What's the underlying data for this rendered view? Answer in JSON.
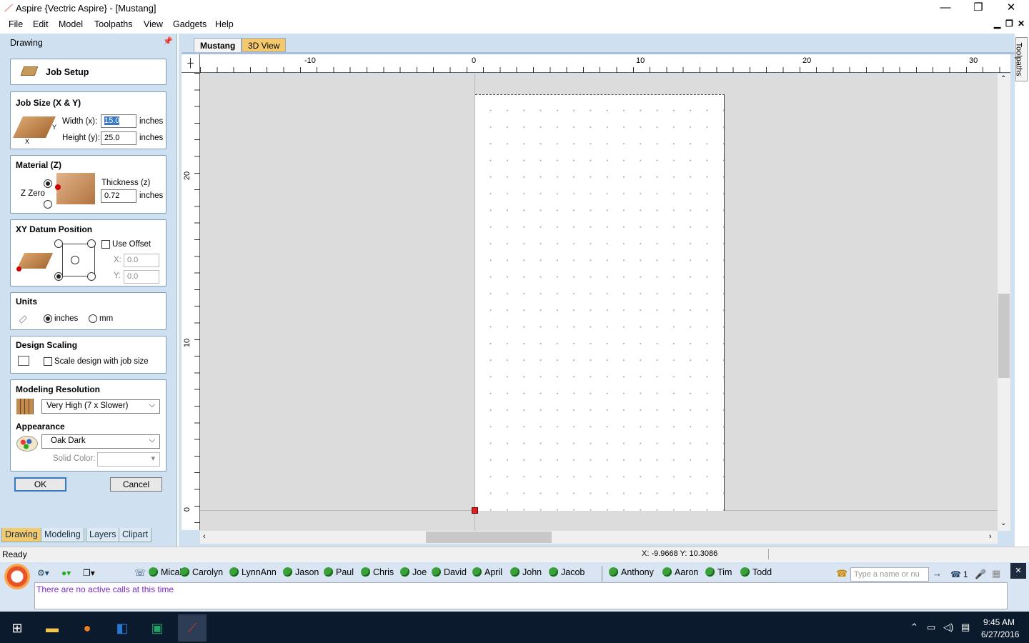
{
  "window": {
    "title": "Aspire {Vectric Aspire} - [Mustang]"
  },
  "menu": [
    "File",
    "Edit",
    "Model",
    "Toolpaths",
    "View",
    "Gadgets",
    "Help"
  ],
  "panel": {
    "title": "Drawing",
    "job_setup": "Job Setup",
    "job_size": {
      "title": "Job Size (X & Y)",
      "width_label": "Width (x):",
      "width_value": "15.0",
      "height_label": "Height (y):",
      "height_value": "25.0",
      "unit": "inches",
      "x": "X",
      "y": "Y"
    },
    "material": {
      "title": "Material (Z)",
      "zzero": "Z Zero",
      "thickness_label": "Thickness (z)",
      "thickness_value": "0.72",
      "unit": "inches"
    },
    "datum": {
      "title": "XY Datum Position",
      "use_offset": "Use Offset",
      "x_label": "X:",
      "x_value": "0.0",
      "y_label": "Y:",
      "y_value": "0.0"
    },
    "units": {
      "title": "Units",
      "inches": "inches",
      "mm": "mm"
    },
    "scaling": {
      "title": "Design Scaling",
      "label": "Scale design with job size"
    },
    "resolution": {
      "title": "Modeling Resolution",
      "value": "Very High (7 x Slower)"
    },
    "appearance": {
      "title": "Appearance",
      "value": "Oak Dark",
      "solid_color": "Solid Color:"
    },
    "ok": "OK",
    "cancel": "Cancel",
    "tabs": [
      "Drawing",
      "Modeling",
      "Layers",
      "Clipart"
    ]
  },
  "doc": {
    "tabs": [
      "Mustang",
      "3D View"
    ],
    "toolpaths_tab": "Toolpaths",
    "ruler_top": [
      "-10",
      "0",
      "10",
      "20",
      "30"
    ],
    "ruler_left": [
      "20",
      "10",
      "0"
    ]
  },
  "status": {
    "left": "Ready",
    "coords": "X: -9.9668 Y: 10.3086"
  },
  "phone": {
    "contacts_a": [
      "Micah",
      "Carolyn",
      "LynnAnn",
      "Jason",
      "Paul",
      "Chris",
      "Joe",
      "David",
      "April",
      "John",
      "Jacob"
    ],
    "contacts_b": [
      "Anthony",
      "Aaron",
      "Tim",
      "Todd"
    ],
    "search_placeholder": "Type a name or nu",
    "count": "1",
    "no_calls": "There are no active calls at this time"
  },
  "taskbar": {
    "time": "9:45 AM",
    "date": "6/27/2016"
  },
  "colors": {
    "accent": "#3b78c2",
    "active_tab": "#f4c96d",
    "panel_bg": "#cfe0f1",
    "datum_marker": "#e02020"
  }
}
